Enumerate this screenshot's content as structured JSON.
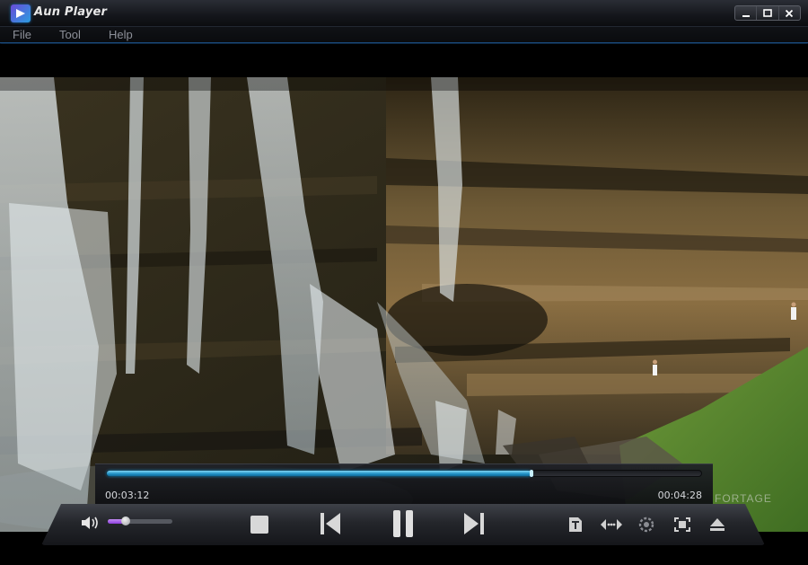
{
  "window": {
    "title": "Aun Player"
  },
  "menu": {
    "items": [
      "File",
      "Tool",
      "Help"
    ]
  },
  "playback": {
    "elapsed": "00:03:12",
    "total": "00:04:28",
    "progress": 0.715
  },
  "volume": {
    "level": 0.28
  },
  "controls": {
    "icons": [
      "volume-icon",
      "stop-icon",
      "previous-icon",
      "pause-icon",
      "next-icon",
      "subtitle-icon",
      "aspect-ratio-icon",
      "settings-icon",
      "fullscreen-icon",
      "eject-icon"
    ]
  },
  "colors": {
    "accent": "#1f8fc4",
    "volume": "#8f3fe0"
  },
  "watermark": {
    "text": "FORTAGE"
  }
}
